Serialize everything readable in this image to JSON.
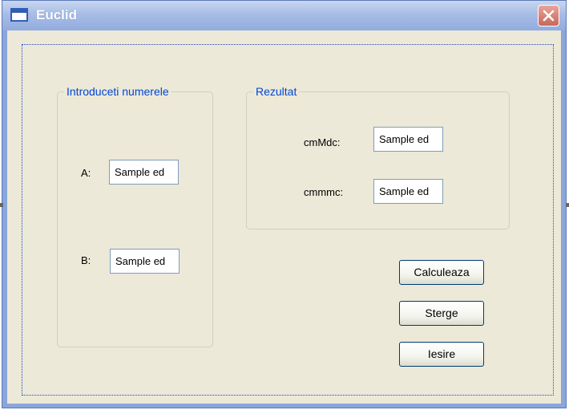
{
  "window": {
    "title": "Euclid"
  },
  "input_group": {
    "legend": "Introduceti numerele",
    "a_label": "A:",
    "a_value": "Sample ed",
    "b_label": "B:",
    "b_value": "Sample ed"
  },
  "result_group": {
    "legend": "Rezultat",
    "cmmdc_label": "cmMdc:",
    "cmmdc_value": "Sample ed",
    "cmmmc_label": "cmmmc:",
    "cmmmc_value": "Sample ed"
  },
  "buttons": {
    "calculate": "Calculeaza",
    "clear": "Sterge",
    "exit": "Iesire"
  },
  "colors": {
    "titlebar": "#a7bde6",
    "client_bg": "#ece9d8",
    "legend_text": "#0046d5",
    "close_button": "#c8665a"
  },
  "icons": [
    "window-icon",
    "close-icon"
  ]
}
